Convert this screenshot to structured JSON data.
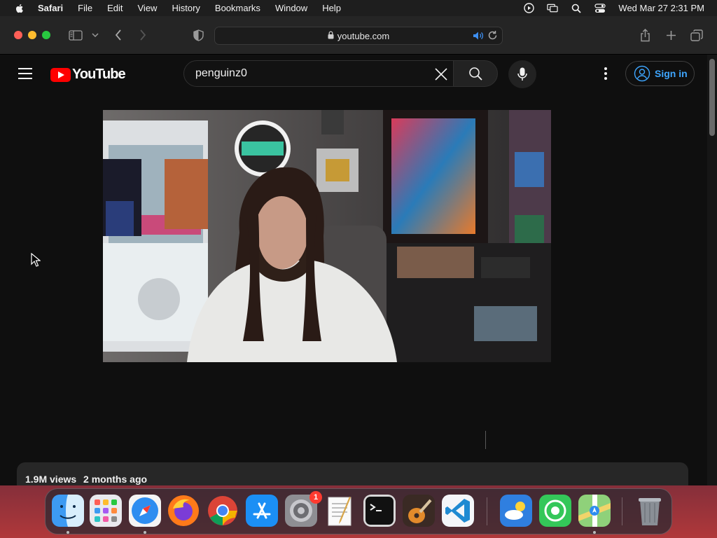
{
  "menubar": {
    "app_name": "Safari",
    "items": [
      "File",
      "Edit",
      "View",
      "History",
      "Bookmarks",
      "Window",
      "Help"
    ],
    "clock": "Wed Mar 27  2:31 PM"
  },
  "browser": {
    "url": "youtube.com"
  },
  "youtube": {
    "logo_text": "YouTube",
    "search_query": "penguinz0",
    "sign_in_label": "Sign in",
    "views": "1.9M views",
    "date": "2 months ago"
  },
  "dock": {
    "apps": [
      "Finder",
      "Launchpad",
      "Safari",
      "Firefox",
      "Chrome",
      "App Store",
      "System Settings",
      "TextEdit",
      "Terminal",
      "GarageBand",
      "Visual Studio Code",
      "Weather",
      "Find My",
      "Maps",
      "Trash"
    ],
    "settings_badge": "1"
  },
  "colors": {
    "yt_red": "#ff0000",
    "link_blue": "#3ea6ff",
    "page_bg": "#0f0f0f"
  }
}
